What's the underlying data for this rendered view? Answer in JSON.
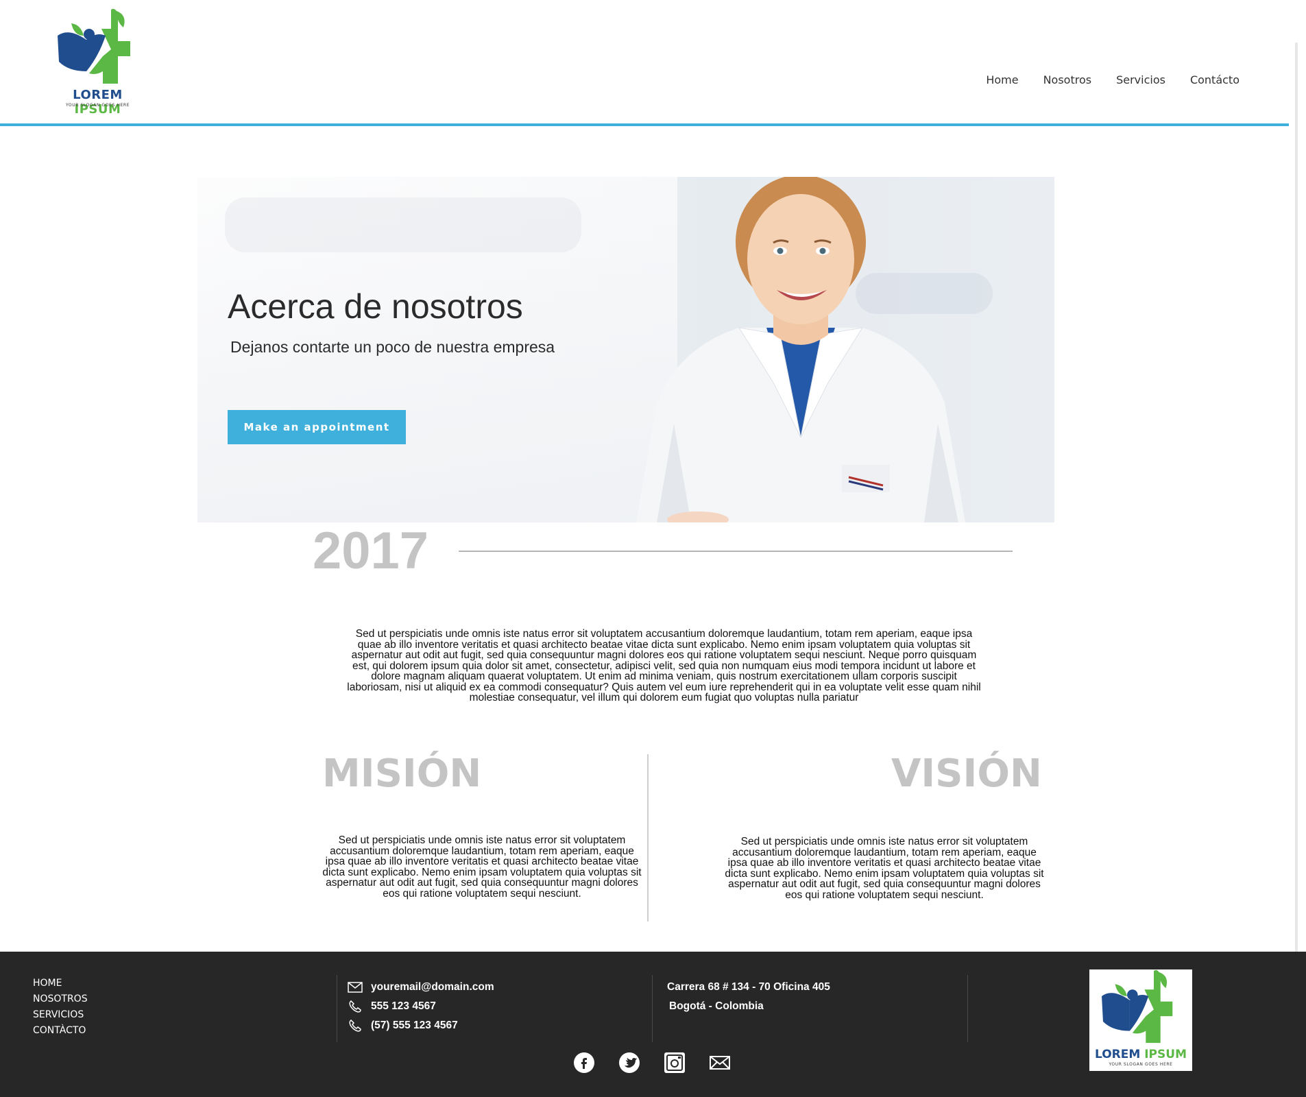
{
  "brand": {
    "name_part1": "LOREM",
    "name_part2": "IPSUM",
    "slogan": "YOUR SLOGAN GOES HERE",
    "colors": {
      "blue": "#1f4d8e",
      "green": "#5cb845",
      "accent": "#3fb0db"
    }
  },
  "nav": {
    "items": [
      {
        "label": "Home"
      },
      {
        "label": "Nosotros"
      },
      {
        "label": "Servicios"
      },
      {
        "label": "Contácto"
      }
    ]
  },
  "hero": {
    "title": "Acerca de nosotros",
    "subtitle": "Dejanos contarte un poco de nuestra empresa",
    "button_label": "Make an appointment"
  },
  "year": "2017",
  "intro": "Sed ut perspiciatis unde omnis iste natus error sit voluptatem accusantium doloremque laudantium, totam rem aperiam, eaque ipsa quae ab illo inventore veritatis et quasi architecto beatae vitae dicta sunt explicabo. Nemo enim ipsam voluptatem quia voluptas sit aspernatur aut odit aut fugit, sed quia consequuntur magni dolores eos qui ratione voluptatem sequi nesciunt. Neque porro quisquam est, qui dolorem ipsum quia dolor sit amet, consectetur, adipisci velit, sed quia non numquam eius modi tempora incidunt ut labore et dolore magnam aliquam quaerat voluptatem. Ut enim ad minima veniam, quis nostrum exercitationem ullam corporis suscipit laboriosam, nisi ut aliquid ex ea commodi consequatur? Quis autem vel eum iure reprehenderit qui in ea voluptate velit esse quam nihil molestiae consequatur, vel illum qui dolorem eum fugiat quo voluptas nulla pariatur",
  "mision": {
    "title": "MISIÓN",
    "text": "Sed ut perspiciatis unde omnis iste natus error sit voluptatem accusantium doloremque laudantium, totam rem aperiam, eaque ipsa quae ab illo inventore veritatis et quasi architecto beatae vitae dicta sunt explicabo. Nemo enim ipsam voluptatem quia voluptas sit aspernatur aut odit aut fugit, sed quia consequuntur magni dolores eos qui ratione voluptatem sequi nesciunt."
  },
  "vision": {
    "title": "VISIÓN",
    "text": "Sed ut perspiciatis unde omnis iste natus error sit voluptatem accusantium doloremque laudantium, totam rem aperiam, eaque ipsa quae ab illo inventore veritatis et quasi architecto beatae vitae dicta sunt explicabo. Nemo enim ipsam voluptatem quia voluptas sit aspernatur aut odit aut fugit, sed quia consequuntur magni dolores eos qui ratione voluptatem sequi nesciunt."
  },
  "footer": {
    "links": [
      "HOME",
      "NOSOTROS",
      "SERVICIOS",
      "CONTÀCTO"
    ],
    "email": "youremail@domain.com",
    "phone1": "555 123 4567",
    "phone2": "(57) 555 123 4567",
    "address_line1": "Carrera 68 # 134 - 70 Oficina 405",
    "address_line2": "Bogotá - Colombia",
    "social_icons": [
      "facebook-icon",
      "twitter-icon",
      "instagram-icon",
      "mail-icon"
    ],
    "background": "#272727"
  }
}
